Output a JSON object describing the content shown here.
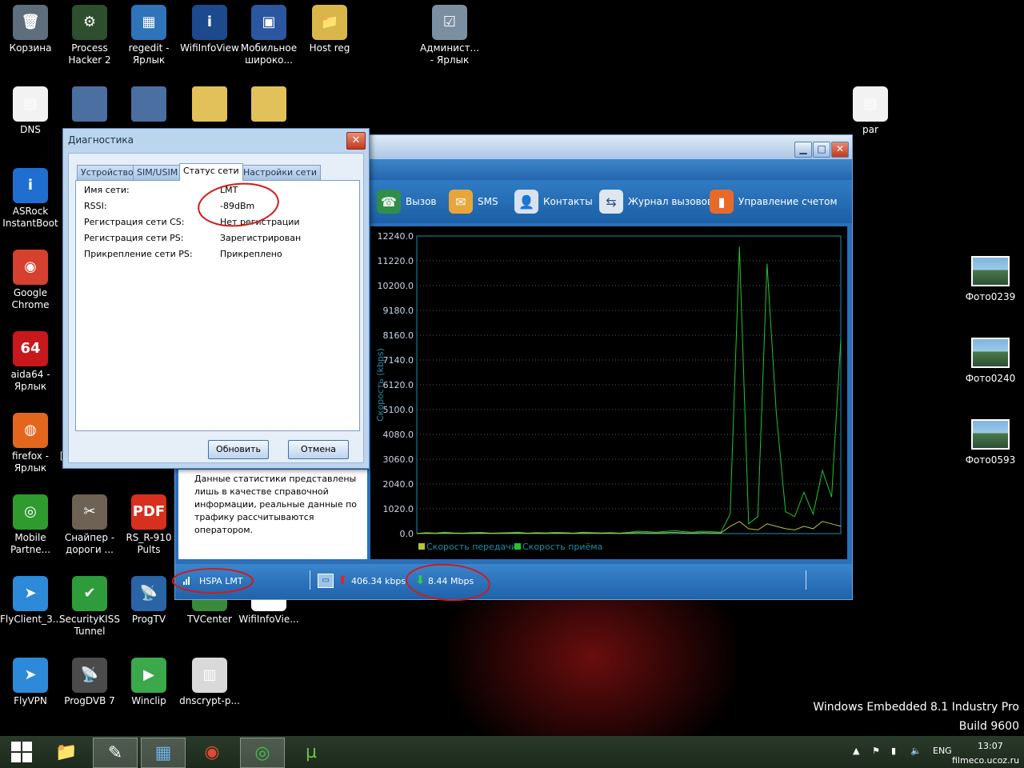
{
  "desktop": {
    "icons": [
      {
        "label": "Корзина",
        "glyph": "🗑",
        "bg": "#5f6e7d"
      },
      {
        "label": "Process\nHacker 2",
        "glyph": "⚙",
        "bg": "#2d4f2d"
      },
      {
        "label": "regedit -\nЯрлык",
        "glyph": "▦",
        "bg": "#2f73b8"
      },
      {
        "label": "WifiInfoView",
        "glyph": "i",
        "bg": "#1d4a8c"
      },
      {
        "label": "Мобильное\nшироко...",
        "glyph": "▣",
        "bg": "#2a57a0"
      },
      {
        "label": "Host reg",
        "glyph": "📁",
        "bg": "#d9b64a"
      },
      {
        "label": "Админист...\n- Ярлык",
        "glyph": "☑",
        "bg": "#7b8fa3"
      },
      {
        "label": "DNS",
        "glyph": "▤",
        "bg": "#f2f2f2"
      },
      {
        "label": "par",
        "glyph": "▤",
        "bg": "#f2f2f2"
      },
      {
        "label": "ASRock\nInstantBoot",
        "glyph": "i",
        "bg": "#1f6fd1"
      },
      {
        "label": "Google\nChrome",
        "glyph": "◉",
        "bg": "#d6402f"
      },
      {
        "label": "aida64 -\nЯрлык",
        "glyph": "64",
        "bg": "#c7181b"
      },
      {
        "label": "firefox -\nЯрлык",
        "glyph": "◍",
        "bg": "#e3661c"
      },
      {
        "label": "[Анти]кил...",
        "glyph": "",
        "bg": "#000000"
      },
      {
        "label": "Mobile\nPartne...",
        "glyph": "◎",
        "bg": "#2f9b2f"
      },
      {
        "label": "Снайпер -\nдороги ...",
        "glyph": "✂",
        "bg": "#6d6253"
      },
      {
        "label": "RS_R-910\nPults",
        "glyph": "PDF",
        "bg": "#d7301e"
      },
      {
        "label": "FlyClient_3...",
        "glyph": "➤",
        "bg": "#2c8ad9"
      },
      {
        "label": "SecurityKISS\nTunnel",
        "glyph": "✔",
        "bg": "#2e9c3a"
      },
      {
        "label": "ProgTV",
        "glyph": "📡",
        "bg": "#2a63a6"
      },
      {
        "label": "TVCenter",
        "glyph": "",
        "bg": "#3a8a3a"
      },
      {
        "label": "WifiInfoVie...",
        "glyph": "",
        "bg": "#ffffff"
      },
      {
        "label": "FlyVPN",
        "glyph": "➤",
        "bg": "#2c8ad9"
      },
      {
        "label": "ProgDVB 7",
        "glyph": "📡",
        "bg": "#4b4b4b"
      },
      {
        "label": "Winclip",
        "glyph": "▶",
        "bg": "#3aa84b"
      },
      {
        "label": "dnscrypt-p...",
        "glyph": "▥",
        "bg": "#d9d9d9"
      },
      {
        "label": "Фото0239",
        "glyph": "",
        "bg": "#7fb3e0"
      },
      {
        "label": "Фото0240",
        "glyph": "",
        "bg": "#7fb3e0"
      },
      {
        "label": "Фото0593",
        "glyph": "",
        "bg": "#7fb3e0"
      }
    ],
    "watermark_line1": "Windows Embedded 8.1 Industry Pro",
    "watermark_line2": "Build 9600"
  },
  "app": {
    "toolbar": {
      "call": "Вызов",
      "sms": "SMS",
      "contacts": "Контакты",
      "call_log": "Журнал вызовов",
      "account": "Управление счетом"
    },
    "note": "Данные статистики представлены лишь в качестве справочной информации, реальные данные по трафику рассчитываются оператором.",
    "status": {
      "network": "HSPA  LMT",
      "upload": "406.34 kbps",
      "download": "8.44 Mbps"
    }
  },
  "chart_data": {
    "type": "line",
    "ylabel": "Скорость (kbps)",
    "ylim": [
      0,
      12240
    ],
    "yticks": [
      "12240.0",
      "11220.0",
      "10200.0",
      "9180.0",
      "8160.0",
      "7140.0",
      "6120.0",
      "5100.0",
      "4080.0",
      "3060.0",
      "2040.0",
      "1020.0",
      "0.0"
    ],
    "grid": true,
    "legend_position": "bottom",
    "series": [
      {
        "name": "Скорость передачи",
        "color": "#b8c33a",
        "values": [
          0,
          20,
          10,
          30,
          15,
          10,
          20,
          25,
          10,
          15,
          20,
          30,
          10,
          20,
          15,
          25,
          20,
          10,
          30,
          20,
          15,
          20,
          10,
          25,
          40,
          30,
          20,
          35,
          50,
          30,
          20,
          40,
          30,
          25,
          300,
          500,
          200,
          150,
          400,
          300,
          200,
          150,
          300,
          200,
          500,
          400,
          300
        ]
      },
      {
        "name": "Скорость приёма",
        "color": "#22c42a",
        "values": [
          0,
          40,
          20,
          60,
          30,
          20,
          40,
          50,
          20,
          30,
          40,
          60,
          20,
          40,
          30,
          50,
          40,
          20,
          60,
          40,
          30,
          40,
          20,
          50,
          100,
          80,
          60,
          90,
          120,
          80,
          60,
          100,
          80,
          60,
          800,
          11800,
          400,
          700,
          11100,
          5000,
          900,
          700,
          1700,
          800,
          2600,
          1500,
          8000
        ]
      }
    ]
  },
  "dialog": {
    "title": "Диагностика",
    "close": "✕",
    "tabs": [
      "Устройство",
      "SIM/USIM",
      "Статус сети",
      "Настройки сети"
    ],
    "rows": [
      {
        "label": "Имя сети:",
        "value": "LMT"
      },
      {
        "label": "RSSI:",
        "value": "-89dBm"
      },
      {
        "label": "Регистрация сети CS:",
        "value": "Нет регистрации"
      },
      {
        "label": "Регистрация сети PS:",
        "value": "Зарегистрирован"
      },
      {
        "label": "Прикрепление сети PS:",
        "value": "Прикреплено"
      }
    ],
    "refresh": "Обновить",
    "cancel": "Отмена"
  },
  "taskbar": {
    "lang": "ENG",
    "time": "13:07"
  },
  "site_watermark": "filmeco.ucoz.ru"
}
